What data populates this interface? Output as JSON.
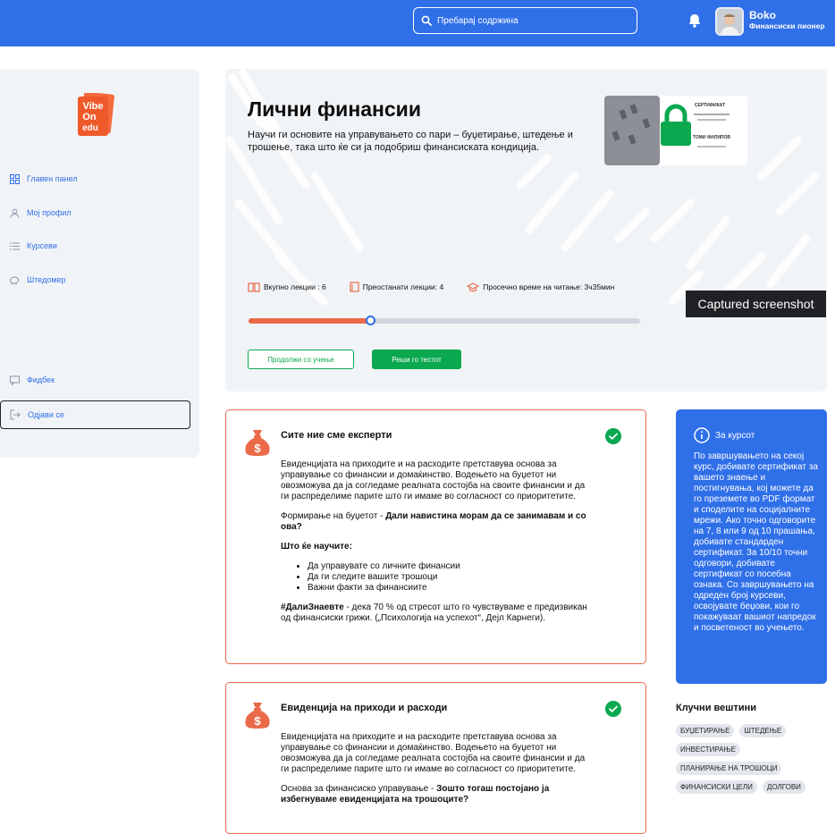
{
  "header": {
    "search_placeholder": "Пребарај содржина",
    "user_name": "Boko",
    "user_role": "Финансиски пионер"
  },
  "sidebar": {
    "logo_text": [
      "Vibe",
      "On",
      "edu"
    ],
    "items": [
      {
        "label": "Главен панел",
        "icon": "dashboard-icon"
      },
      {
        "label": "Мој профил",
        "icon": "user-icon"
      },
      {
        "label": "Курсеви",
        "icon": "list-icon"
      },
      {
        "label": "Штедомер",
        "icon": "piggy-bank-icon"
      }
    ],
    "feedback_label": "Фидбек",
    "logout_label": "Одјави се"
  },
  "hero": {
    "title": "Лични финансии",
    "description": "Научи ги основите на управувањето со пари – буџетирање, штедење и трошење, така што ќе си ја подобриш финансиската кондиција.",
    "stats": {
      "total_lectures": "Вкупно лекции : 6",
      "remaining_lectures": "Преостанати лекции: 4",
      "avg_reading_time": "Просечно време на читање: 3ч35мин"
    },
    "progress_fraction": 0.31,
    "continue_label": "Продолжи со учење",
    "test_label": "Реши го тестот",
    "certificate": {
      "heading": "СЕРТИФИКАТ",
      "name_line": "ТОМИ ФИЛИПОВ"
    }
  },
  "tooltip": "Captured screenshot",
  "lessons": [
    {
      "title": "Сите ние сме експерти",
      "paragraph1": "Евиденцијата на приходите и на расходите претставува основа за управување со финансии и домаќинство. Водењето на буџетот ни овозможува да ја согледаме реалната состојба на своите финансии и да ги распределиме парите што ги имаме во согласност со приоритетите.",
      "p2_prefix": "Формирање на буџетот - ",
      "p2_bold": "Дали навистина морам да се занимавам и со ова?",
      "learn_heading": "Што ќе научите:",
      "bullets": [
        "Да управувате со личните финансии",
        "Да ги следите вашите трошоци",
        "Важни факти за финансиите"
      ],
      "fact_bold": "#ДалиЗнаевте",
      "fact_text": " - дека 70 % од стресот што го чувствуваме е предизвикан од финансиски грижи. („Психологија на успехот“, Дејл Карнеги)."
    },
    {
      "title": "Евиденција на приходи и расходи",
      "paragraph1": "Евиденцијата на приходите и на расходите претставува основа за управување со финансии и домаќинство. Водењето на буџетот ни овозможува да ја согледаме реалната состојба на своите финансии и да ги распределиме парите што ги имаме во согласност со приоритетите.",
      "p2_prefix": "Основа за финансиско управување - ",
      "p2_bold": "Зошто тогаш постојано ја избегнуваме евиденцијата на трошоците?"
    }
  ],
  "about": {
    "heading": "За курсот",
    "text": "По завршувањето на секој курс, добивате сертификат за вашето знаење и постигнувања, кој можете да го преземете во PDF формат и споделите на социјалните мрежи. Ако точно одговорите на 7, 8 или 9 од 10 прашања, добивате стандарден сертификат. За 10/10 точни одговори, добивате сертификат со посебна ознака. Со завршувањето на одреден број курсеви, освојувате беџови, кои го покажуваат вашиот напредок и посветеност во учењето."
  },
  "skills": {
    "title": "Клучни вештини",
    "tags": [
      "БУЏЕТИРАЊЕ",
      "ШТЕДЕЊЕ",
      "ИНВЕСТИРАЊЕ",
      "ПЛАНИРАЊЕ НА ТРОШОЦИ",
      "ФИНАНСИСКИ ЦЕЛИ",
      "ДОЛГОВИ"
    ]
  },
  "colors": {
    "primary": "#2f6fe8",
    "accent_orange": "#ea6a4a",
    "success": "#0aa84f",
    "panel_bg": "#f1f4f7"
  }
}
